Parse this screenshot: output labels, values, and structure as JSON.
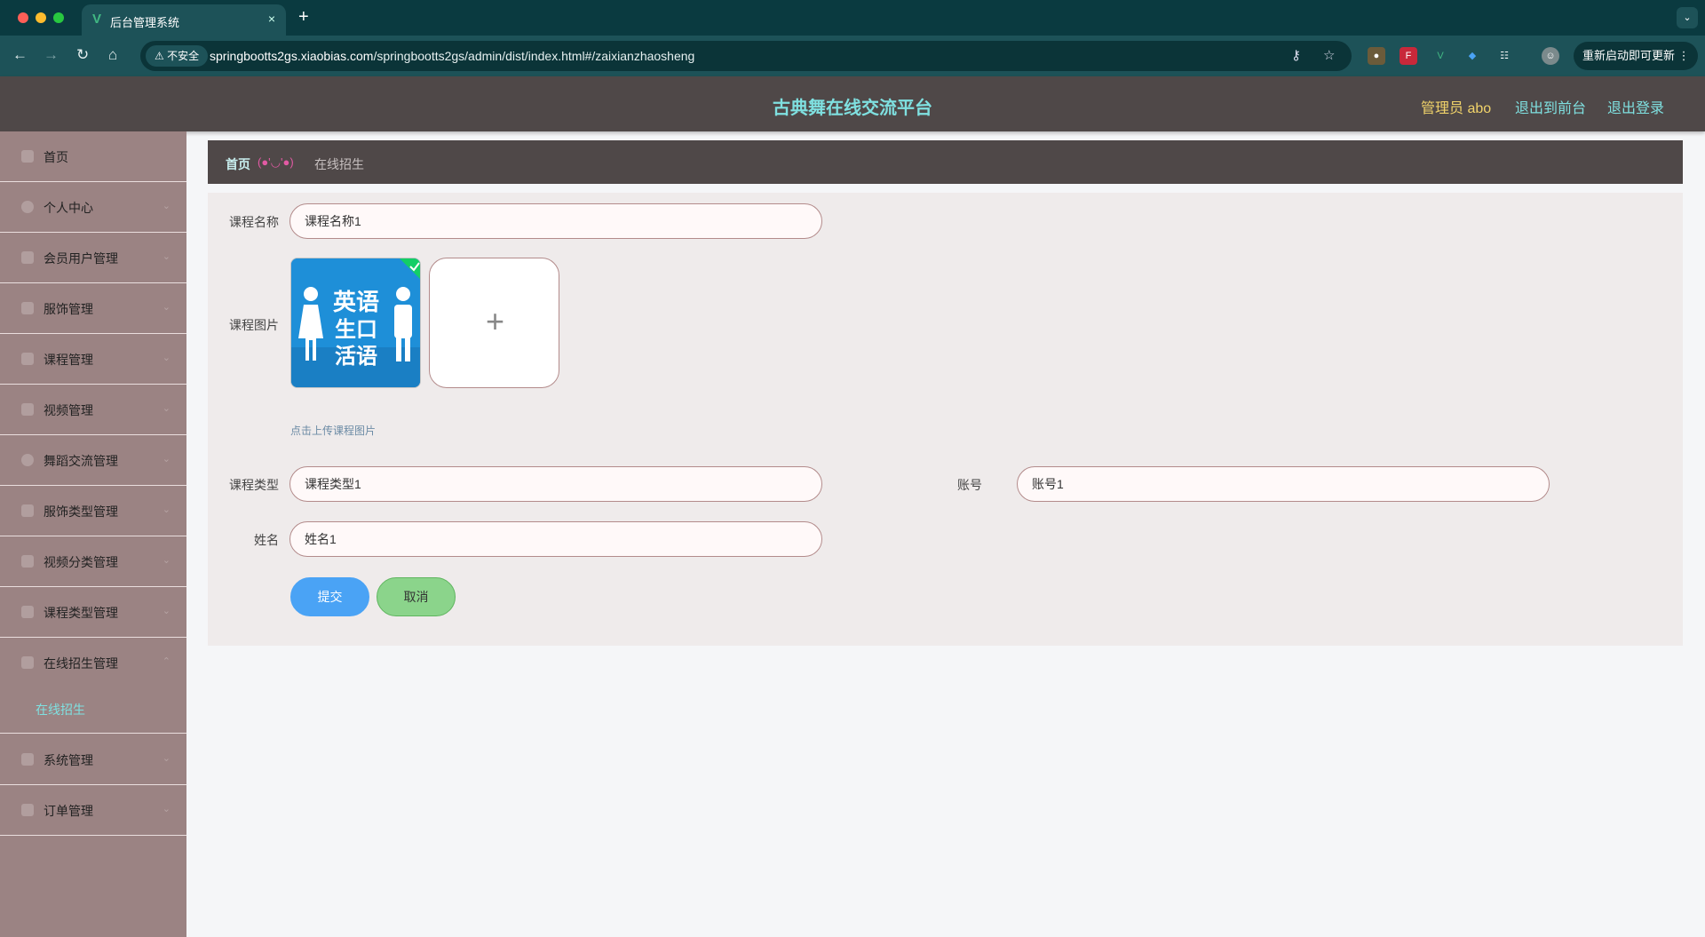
{
  "browser": {
    "tab_title": "后台管理系统",
    "tab_close": "×",
    "new_tab": "+",
    "insecure_label": "不安全",
    "url_host": "springbootts2gs.xiaobias.com",
    "url_path": "/springbootts2gs/admin/dist/index.html#/zaixianzhaosheng",
    "update_label": "重新启动即可更新"
  },
  "header": {
    "title": "古典舞在线交流平台",
    "user": "管理员 abo",
    "to_front": "退出到前台",
    "logout": "退出登录"
  },
  "sidebar": {
    "items": [
      {
        "label": "首页",
        "has_arrow": false
      },
      {
        "label": "个人中心",
        "has_arrow": true
      },
      {
        "label": "会员用户管理",
        "has_arrow": true
      },
      {
        "label": "服饰管理",
        "has_arrow": true
      },
      {
        "label": "课程管理",
        "has_arrow": true
      },
      {
        "label": "视频管理",
        "has_arrow": true
      },
      {
        "label": "舞蹈交流管理",
        "has_arrow": true
      },
      {
        "label": "服饰类型管理",
        "has_arrow": true
      },
      {
        "label": "视频分类管理",
        "has_arrow": true
      },
      {
        "label": "课程类型管理",
        "has_arrow": true
      },
      {
        "label": "在线招生管理",
        "has_arrow": true,
        "expanded": true
      },
      {
        "label": "系统管理",
        "has_arrow": true
      },
      {
        "label": "订单管理",
        "has_arrow": true
      }
    ],
    "subitem": "在线招生"
  },
  "breadcrumb": {
    "home": "首页",
    "separator": "(●'◡'●)",
    "current": "在线招生"
  },
  "form": {
    "course_name_label": "课程名称",
    "course_name_value": "课程名称1",
    "course_image_label": "课程图片",
    "image_text_top": "英语",
    "image_text_mid": "生口",
    "image_text_bot": "活语",
    "upload_plus": "+",
    "upload_hint": "点击上传课程图片",
    "course_type_label": "课程类型",
    "course_type_value": "课程类型1",
    "account_label": "账号",
    "account_value": "账号1",
    "name_label": "姓名",
    "name_value": "姓名1",
    "submit": "提交",
    "cancel": "取消"
  },
  "colors": {
    "tabbar": "#0a3a40",
    "header": "#4f4848",
    "sidebar": "#9b8383",
    "accent": "#7fe0e0",
    "submit": "#4aa3f5",
    "cancel": "#8bd48b"
  }
}
